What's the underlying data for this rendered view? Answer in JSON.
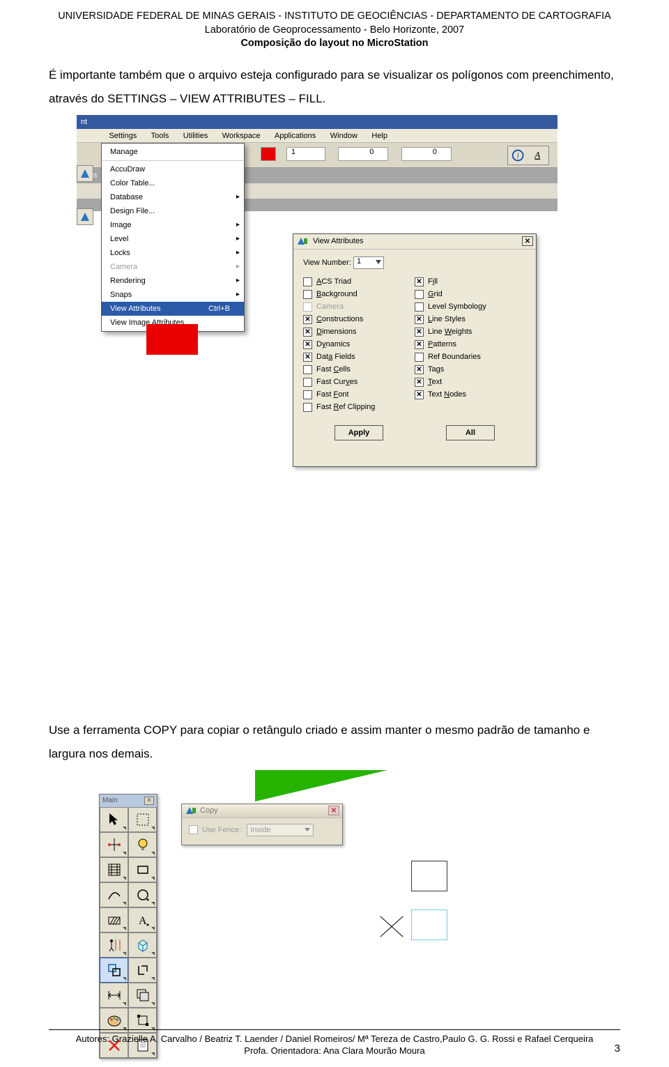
{
  "header": {
    "line1": "UNIVERSIDADE FEDERAL DE MINAS GERAIS - INSTITUTO DE GEOCIÊNCIAS - DEPARTAMENTO DE CARTOGRAFIA",
    "line2": "Laboratório de Geoprocessamento - Belo Horizonte, 2007",
    "line3": "Composição do layout no MicroStation"
  },
  "para1": "É importante também que o arquivo esteja configurado para se visualizar os polígonos com preenchimento, através do SETTINGS – VIEW ATTRIBUTES – FILL.",
  "para2": "Use a ferramenta COPY para copiar o retângulo criado e assim manter o mesmo padrão de tamanho e largura nos demais.",
  "footer": {
    "line1": "Autores: Grazielle A. Carvalho / Beatriz T. Laender / Daniel Romeiros/ Mª Tereza de Castro,Paulo G. G. Rossi e Rafael Cerqueira",
    "line2": "Profa. Orientadora: Ana Clara Mourão Moura",
    "page": "3"
  },
  "shot1": {
    "nt": "nt",
    "menubar": [
      "Settings",
      "Tools",
      "Utilities",
      "Workspace",
      "Applications",
      "Window",
      "Help"
    ],
    "toolbar": {
      "colorVal": "",
      "num": "1",
      "zero": "0",
      "zero2": "0"
    },
    "winTitle": "Win",
    "menu": {
      "items": [
        {
          "label": "Manage",
          "disabled": false
        },
        {
          "label": "AccuDraw",
          "disabled": false
        },
        {
          "label": "Color Table...",
          "disabled": false
        },
        {
          "label": "Database",
          "sub": true
        },
        {
          "label": "Design File...",
          "disabled": false
        },
        {
          "label": "Image",
          "sub": true
        },
        {
          "label": "Level",
          "sub": true
        },
        {
          "label": "Locks",
          "sub": true
        },
        {
          "label": "Camera",
          "disabled": true,
          "sub": true
        },
        {
          "label": "Rendering",
          "sub": true
        },
        {
          "label": "Snaps",
          "sub": true
        },
        {
          "label": "View Attributes",
          "shortcut": "Ctrl+B",
          "selected": true
        },
        {
          "label": "View Image Attributes"
        }
      ]
    },
    "dialog": {
      "title": "View Attributes",
      "viewNumberLabel": "View Number:",
      "viewNumberVal": "1",
      "left": [
        {
          "label": "ACS Triad",
          "ul": "A",
          "checked": false
        },
        {
          "label": "Background",
          "ul": "B",
          "checked": false
        },
        {
          "label": "Camera",
          "ul": "",
          "checked": false,
          "disabled": true
        },
        {
          "label": "Constructions",
          "ul": "C",
          "checked": true
        },
        {
          "label": "Dimensions",
          "ul": "D",
          "checked": true
        },
        {
          "label": "Dynamics",
          "ul": "D",
          "checked": true
        },
        {
          "label": "Data Fields",
          "ul": "D",
          "checked": true
        },
        {
          "label": "Fast Cells",
          "ul": "C",
          "checked": false
        },
        {
          "label": "Fast Curves",
          "ul": "",
          "checked": false
        },
        {
          "label": "Fast Font",
          "ul": "F",
          "checked": false
        },
        {
          "label": "Fast Ref Clipping",
          "ul": "R",
          "checked": false
        }
      ],
      "right": [
        {
          "label": "Fill",
          "ul": "F",
          "checked": true
        },
        {
          "label": "Grid",
          "ul": "G",
          "checked": false
        },
        {
          "label": "Level Symbology",
          "ul": "",
          "checked": false
        },
        {
          "label": "Line Styles",
          "ul": "L",
          "checked": true
        },
        {
          "label": "Line Weights",
          "ul": "W",
          "checked": true
        },
        {
          "label": "Patterns",
          "ul": "P",
          "checked": true
        },
        {
          "label": "Ref Boundaries",
          "ul": "",
          "checked": false
        },
        {
          "label": "Tags",
          "ul": "T",
          "checked": true
        },
        {
          "label": "Text",
          "ul": "T",
          "checked": true
        },
        {
          "label": "Text Nodes",
          "ul": "N",
          "checked": true
        }
      ],
      "applyBtn": "Apply",
      "allBtn": "All"
    }
  },
  "shot2": {
    "paletteTitle": "Main",
    "tools": [
      "pointer",
      "selection-marquee",
      "snap-plus",
      "lightbulb",
      "hatch",
      "rectangle",
      "curve",
      "circle",
      "pattern",
      "text-a",
      "measure-person",
      "cube",
      "copy",
      "bracket-shape",
      "dimension",
      "overlap-squares",
      "palette-color",
      "transform",
      "cross-x",
      "sheet"
    ],
    "selectedToolIndex": 12,
    "copy": {
      "title": "Copy",
      "useFence": "Use Fence:",
      "fenceVal": "Inside"
    }
  }
}
